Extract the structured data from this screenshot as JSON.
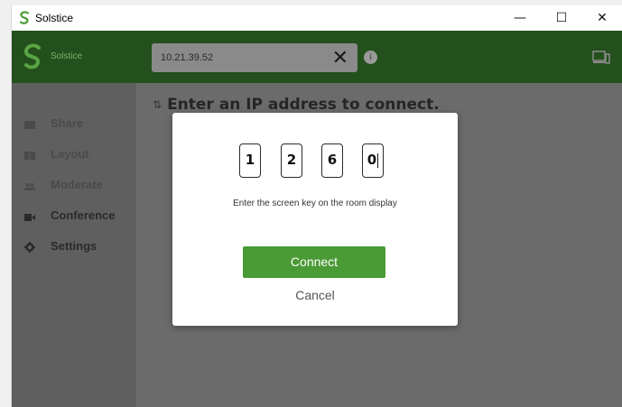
{
  "window": {
    "title": "Solstice",
    "minimize": "—",
    "maximize": "☐",
    "close": "✕"
  },
  "appbar": {
    "logo": "S",
    "name": "Solstice",
    "ip_value": "10.21.39.52",
    "clear": "✕",
    "info": "i",
    "device_icon": "device-icon"
  },
  "hint": {
    "icon": "⇅",
    "text": "Enter an IP address to connect."
  },
  "sidebar": {
    "items": [
      {
        "label": "Share",
        "icon": "monitor-icon"
      },
      {
        "label": "Layout",
        "icon": "layout-icon"
      },
      {
        "label": "Moderate",
        "icon": "people-icon"
      },
      {
        "label": "Conference",
        "icon": "camera-icon"
      },
      {
        "label": "Settings",
        "icon": "gear-icon"
      }
    ]
  },
  "dialog": {
    "key": [
      "1",
      "2",
      "6",
      "0"
    ],
    "help": "Enter the screen key on the room display",
    "connect_label": "Connect",
    "cancel_label": "Cancel"
  },
  "colors": {
    "brand_green": "#4a9a35",
    "appbar": "#23501c",
    "overlay": "#6b6b6b"
  }
}
